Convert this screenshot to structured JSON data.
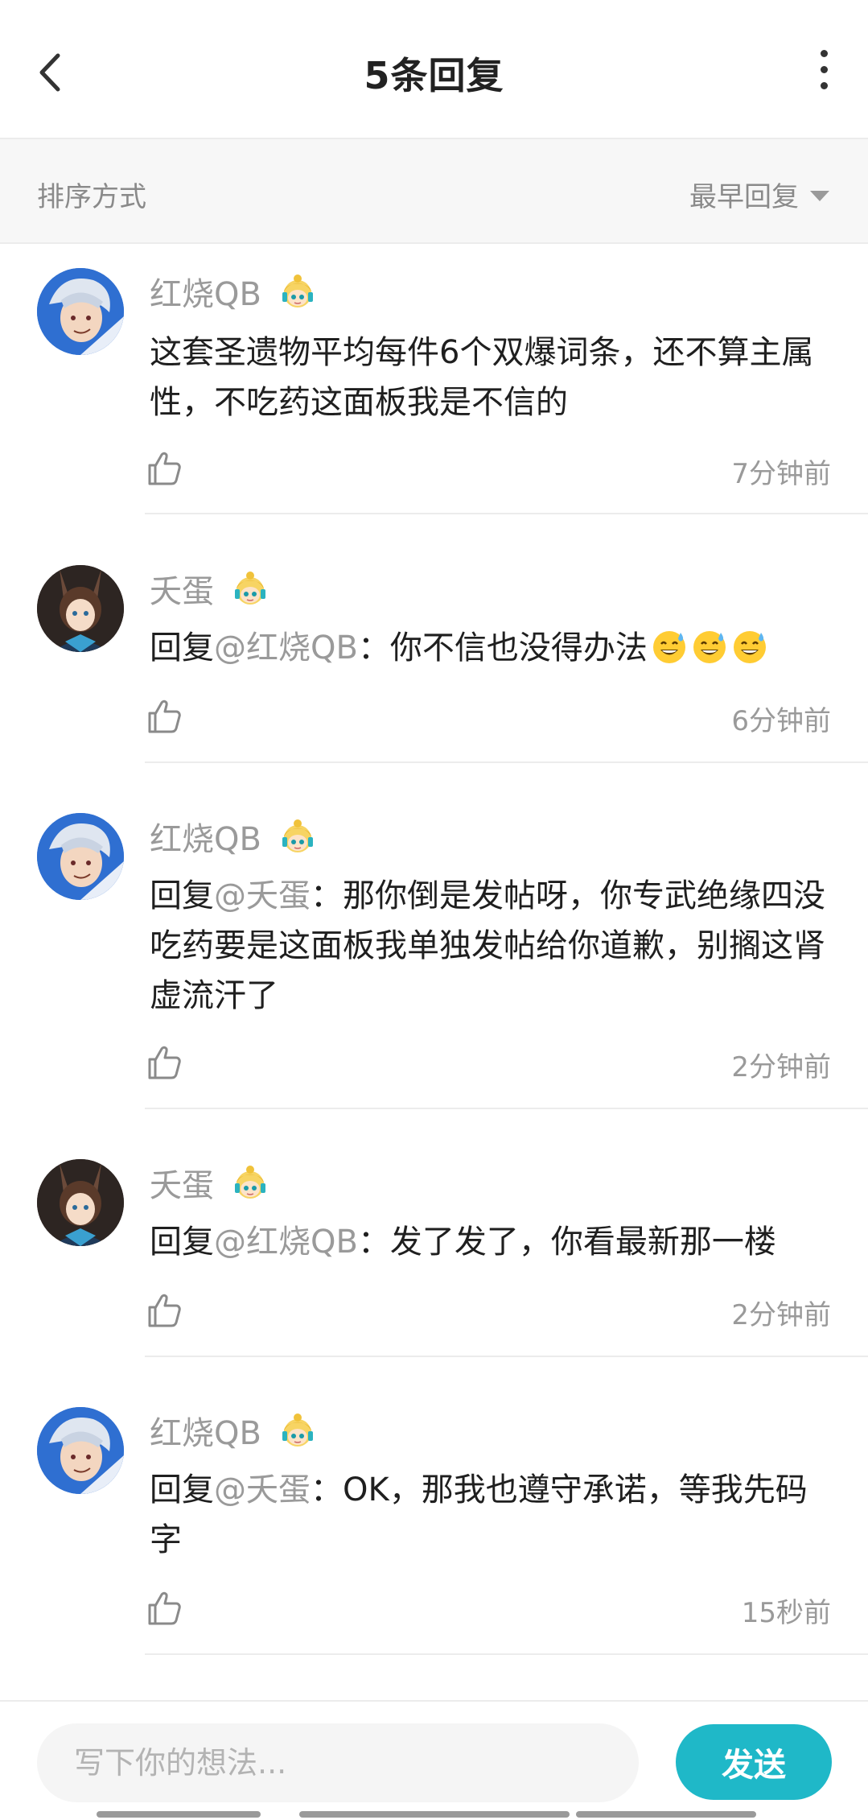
{
  "header": {
    "title": "5条回复"
  },
  "sort": {
    "label": "排序方式",
    "value": "最早回复"
  },
  "comments": [
    {
      "user": "红烧QB",
      "text": "这套圣遗物平均每件6个双爆词条，还不算主属性，不吃药这面板我是不信的",
      "time": "7分钟前"
    },
    {
      "user": "夭蛋",
      "prefix": "回复",
      "mention": "@红烧QB",
      "text": "：你不信也没得办法",
      "time": "6分钟前"
    },
    {
      "user": "红烧QB",
      "prefix": "回复",
      "mention": "@夭蛋",
      "text": "：那你倒是发帖呀，你专武绝缘四没吃药要是这面板我单独发帖给你道歉，别搁这肾虚流汗了",
      "time": "2分钟前"
    },
    {
      "user": "夭蛋",
      "prefix": "回复",
      "mention": "@红烧QB",
      "text": "：发了发了，你看最新那一楼",
      "time": "2分钟前"
    },
    {
      "user": "红烧QB",
      "prefix": "回复",
      "mention": "@夭蛋",
      "text": "：OK，那我也遵守承诺，等我先码字",
      "time": "15秒前"
    }
  ],
  "footer": {
    "placeholder": "写下你的想法...",
    "send_label": "发送"
  }
}
